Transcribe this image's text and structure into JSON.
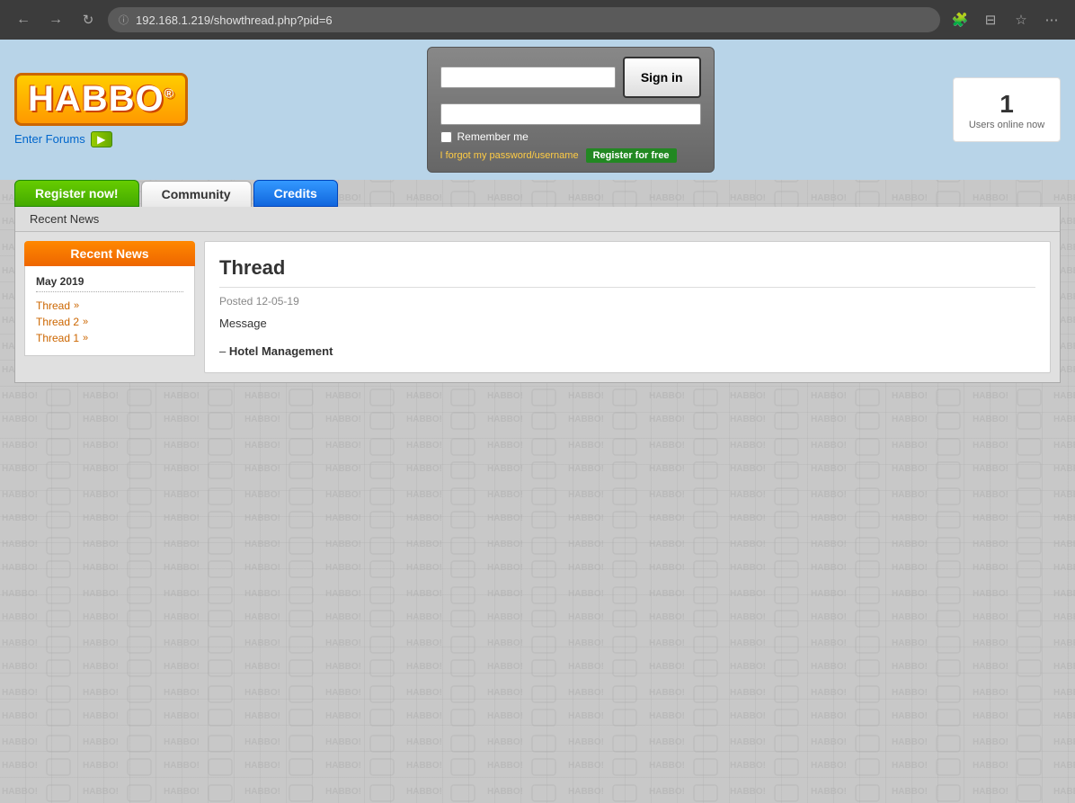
{
  "browser": {
    "url": "192.168.1.219/showthread.php?pid=6",
    "back_label": "←",
    "forward_label": "→",
    "refresh_label": "↻"
  },
  "header": {
    "logo_text": "HABBO",
    "logo_reg": "®",
    "enter_forums_label": "Enter Forums",
    "login": {
      "username_placeholder": "",
      "password_placeholder": "",
      "signin_label": "Sign in",
      "remember_label": "Remember me",
      "forgot_label": "I forgot my password/username",
      "register_free_label": "Register for free"
    },
    "users_online": {
      "count": "1",
      "label": "Users online now"
    }
  },
  "nav": {
    "register_label": "Register now!",
    "community_label": "Community",
    "credits_label": "Credits"
  },
  "breadcrumb": {
    "label": "Recent News"
  },
  "sidebar": {
    "title": "Recent News",
    "month": "May 2019",
    "items": [
      {
        "label": "Thread",
        "url": "#"
      },
      {
        "label": "Thread 2",
        "url": "#"
      },
      {
        "label": "Thread 1",
        "url": "#"
      }
    ]
  },
  "thread": {
    "title": "Thread",
    "posted_label": "Posted",
    "posted_date": "12-05-19",
    "message": "Message",
    "signature_prefix": "–",
    "signature": "Hotel Management"
  }
}
